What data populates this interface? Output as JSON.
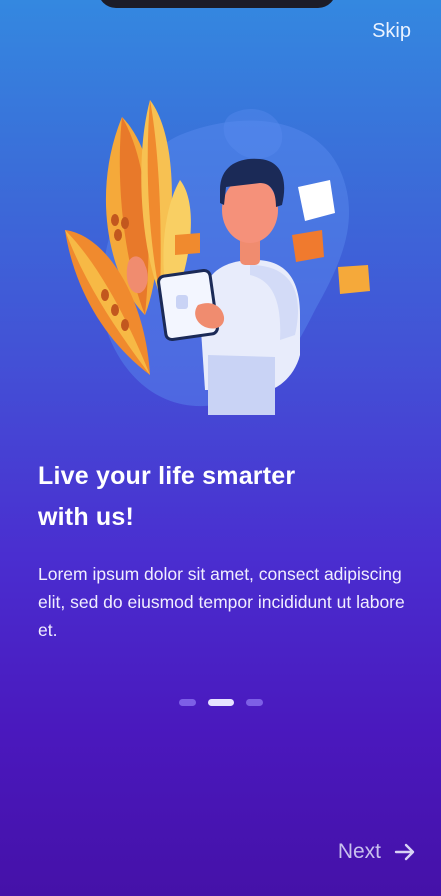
{
  "header": {
    "skip_label": "Skip"
  },
  "onboarding": {
    "illustration_name": "person-with-tablet-illustration",
    "title_line1": "Live your life smarter",
    "title_line2": "with us!",
    "body": "Lorem ipsum dolor sit amet, consect adipiscing elit, sed do eiusmod tempor incididunt ut labore et.",
    "pagination": {
      "total": 3,
      "active_index": 1
    }
  },
  "footer": {
    "next_label": "Next",
    "next_icon": "arrow-right-icon"
  },
  "colors": {
    "gradient_top": "#3488e0",
    "gradient_bottom": "#4511a8",
    "dot_active": "#e6e3ff",
    "dot_inactive": "#a08cff"
  }
}
